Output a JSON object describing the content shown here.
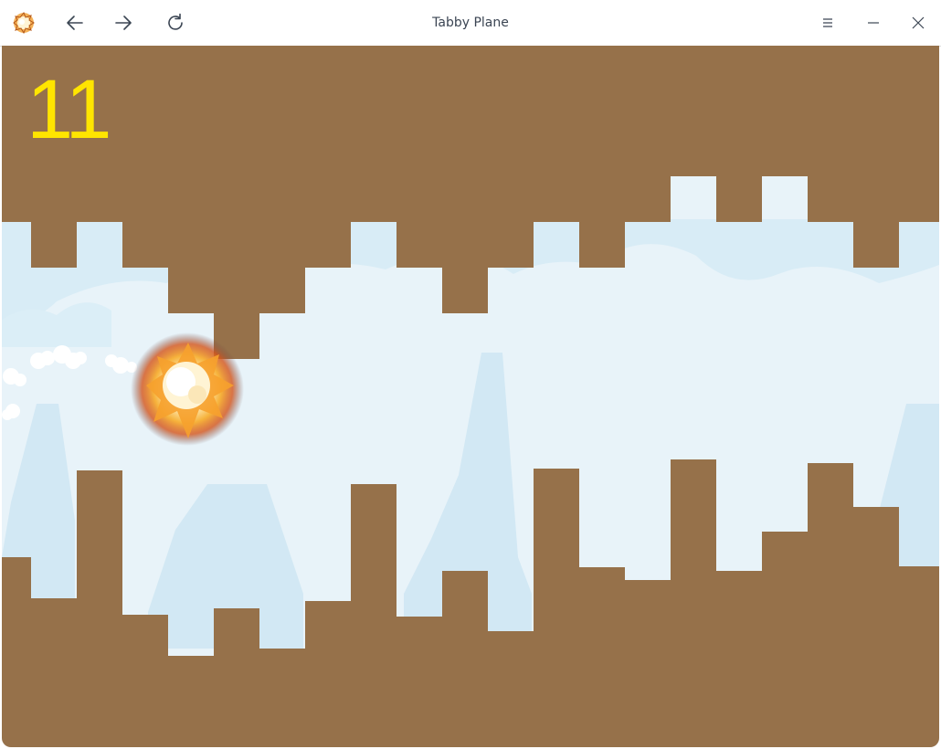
{
  "window": {
    "title": "Tabby Plane",
    "icons": {
      "app": "explosion-app-icon",
      "back": "arrow-left-icon",
      "forward": "arrow-right-icon",
      "reload": "reload-icon",
      "menu": "hamburger-menu-icon",
      "minimize": "minimize-icon",
      "close": "close-icon"
    }
  },
  "game": {
    "score": "11",
    "colors": {
      "ground": "#96714a",
      "sky": "#e8f3f9",
      "cloud_band": "#d8ecf6",
      "score": "#ffe500",
      "explosion_core": "#fff3c9",
      "explosion_fire": "#f08a1a"
    },
    "state": "crashed"
  }
}
